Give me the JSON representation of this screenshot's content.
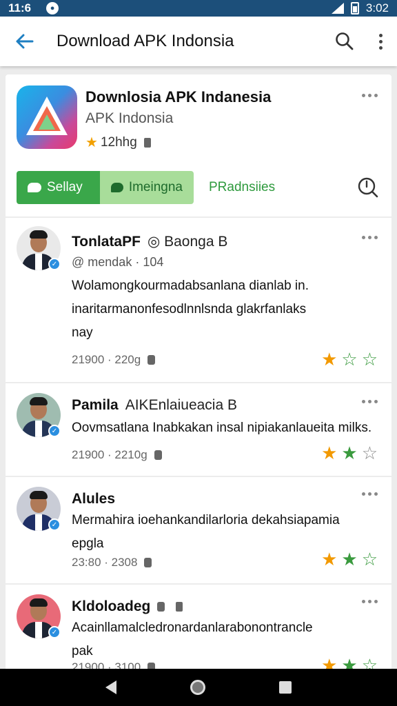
{
  "status_bar": {
    "time": "11:6",
    "clock_right": "3:02"
  },
  "app_bar": {
    "title": "Download APK Indonsia"
  },
  "app": {
    "name": "Downlosia APK Indanesia",
    "subtitle": "APK Indonsia",
    "rating_text": "12hhg",
    "icon_colors": [
      "#19b4ea",
      "#e93a6c"
    ]
  },
  "tabs": [
    {
      "label": "Sellay"
    },
    {
      "label": "Imeingna"
    },
    {
      "label": "PRadnsiies"
    }
  ],
  "reviews": [
    {
      "name": "TonlataPF",
      "extra": "Baonga",
      "extra_badge": "B",
      "handle": "mendak · 104",
      "text_lines": [
        "Wolamongkourmadabsanlana dianlab in.",
        "inaritarmanonfesodlnnlsnda glakrfanlaks",
        "nay"
      ],
      "date": "21900 · 220g",
      "stars": [
        1,
        0,
        0
      ]
    },
    {
      "name": "Pamila",
      "extra": "AIKEnlaiueacia",
      "extra_badge": "B",
      "handle": "",
      "text_lines": [
        "Oovmsatlana Inabkakan insal nipiakanlaueita milks."
      ],
      "date": "21900 · 2210g",
      "stars": [
        1,
        1,
        0
      ]
    },
    {
      "name": "Alules",
      "extra": "",
      "extra_badge": "",
      "handle": "",
      "text_lines": [
        "Mermahira ioehankandilarloria dekahsiapamia",
        "epgla"
      ],
      "date": "23:80 · 2308",
      "stars": [
        1,
        1,
        0
      ]
    },
    {
      "name": "Kldoloadeg",
      "extra": "",
      "extra_badge": "",
      "handle": "",
      "text_lines": [
        "Acainllamalcledronardanlarabonontrancle",
        "pak"
      ],
      "date": "21900 · 3100",
      "stars": [
        1,
        1,
        0
      ]
    }
  ]
}
